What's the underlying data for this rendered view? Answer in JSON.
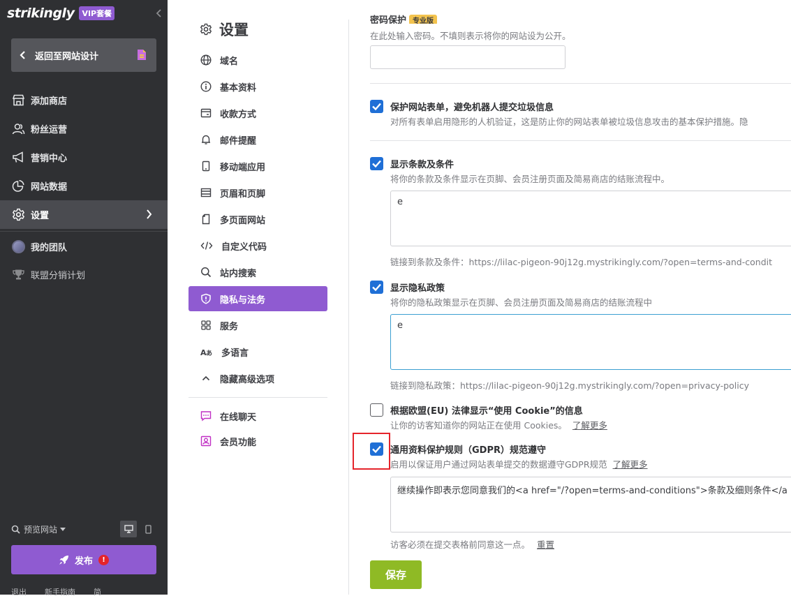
{
  "brand": {
    "logo": "strikingly",
    "badge": "VIP套餐"
  },
  "sidebar": {
    "back_label": "返回至网站设计",
    "items": [
      {
        "label": "添加商店",
        "icon": "store-icon"
      },
      {
        "label": "粉丝运营",
        "icon": "users-icon"
      },
      {
        "label": "营销中心",
        "icon": "megaphone-icon"
      },
      {
        "label": "网站数据",
        "icon": "pie-chart-icon"
      },
      {
        "label": "设置",
        "icon": "gear-icon",
        "active": true
      }
    ],
    "items2": [
      {
        "label": "我的团队",
        "icon": "avatar-icon"
      },
      {
        "label": "联盟分销计划",
        "icon": "trophy-icon"
      }
    ],
    "preview_label": "预览网站",
    "publish_label": "发布",
    "publish_warning": "!",
    "footer": [
      "退出",
      "新手指南",
      "简"
    ]
  },
  "subnav": {
    "title": "设置",
    "items": [
      {
        "label": "域名",
        "icon": "globe-icon"
      },
      {
        "label": "基本资料",
        "icon": "info-icon"
      },
      {
        "label": "收款方式",
        "icon": "payment-icon"
      },
      {
        "label": "邮件提醒",
        "icon": "bell-icon"
      },
      {
        "label": "移动端应用",
        "icon": "mobile-icon"
      },
      {
        "label": "页眉和页脚",
        "icon": "header-footer-icon"
      },
      {
        "label": "多页面网站",
        "icon": "pages-icon"
      },
      {
        "label": "自定义代码",
        "icon": "code-icon"
      },
      {
        "label": "站内搜索",
        "icon": "search-icon"
      },
      {
        "label": "隐私与法务",
        "icon": "shield-icon",
        "active": true
      },
      {
        "label": "服务",
        "icon": "grid-icon"
      },
      {
        "label": "多语言",
        "icon": "language-icon"
      },
      {
        "label": "隐藏高级选项",
        "icon": "chevron-up-icon"
      }
    ],
    "extra": [
      {
        "label": "在线聊天",
        "icon": "chat-icon"
      },
      {
        "label": "会员功能",
        "icon": "member-icon"
      }
    ]
  },
  "main": {
    "password": {
      "label": "密码保护",
      "badge": "专业版",
      "hint": "在此处输入密码。不填则表示将你的网站设为公开。",
      "value": ""
    },
    "spam": {
      "checked": true,
      "title": "保护网站表单，避免机器人提交垃圾信息",
      "hint": "对所有表单启用隐形的人机验证，这是防止你的网站表单被垃圾信息攻击的基本保护措施。隐"
    },
    "terms": {
      "checked": true,
      "title": "显示条款及条件",
      "hint": "将你的条款及条件显示在页脚、会员注册页面及简易商店的结账流程中。",
      "text": "e",
      "link": "链接到条款及条件：https://lilac-pigeon-90j12g.mystrikingly.com/?open=terms-and-condit"
    },
    "privacy": {
      "checked": true,
      "title": "显示隐私政策",
      "hint": "将你的隐私政策显示在页脚、会员注册页面及简易商店的结账流程中",
      "text": "e",
      "link": "链接到隐私政策：https://lilac-pigeon-90j12g.mystrikingly.com/?open=privacy-policy"
    },
    "cookie": {
      "checked": false,
      "title": "根据欧盟(EU) 法律显示“使用 Cookie”的信息",
      "hint": "让你的访客知道你的网站正在使用 Cookies。",
      "learn": "了解更多"
    },
    "gdpr": {
      "checked": true,
      "title": "通用资料保护规则（GDPR）规范遵守",
      "hint": "启用以保证用户通过网站表单提交的数据遵守GDPR规范",
      "learn": "了解更多",
      "text": "继续操作即表示您同意我们的<a href=\"/?open=terms-and-conditions\">条款及细则条件</a",
      "note": "访客必须在提交表格前同意这一点。",
      "reset": "重置"
    },
    "save_label": "保存"
  }
}
